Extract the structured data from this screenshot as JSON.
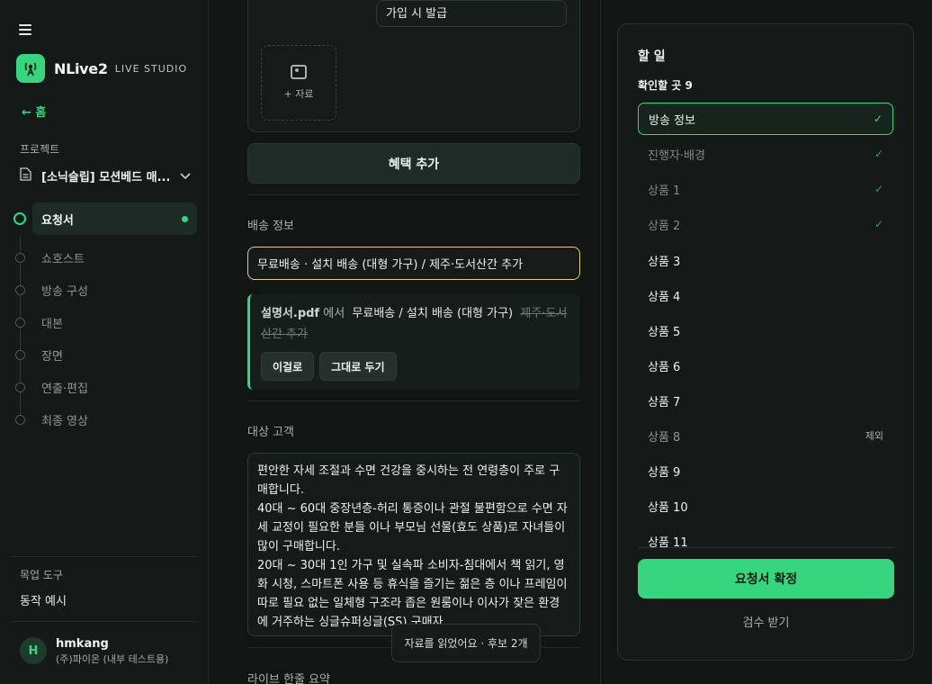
{
  "app": {
    "name": "NLive2",
    "subtitle": "LIVE STUDIO",
    "home": "← 홈"
  },
  "sidebar": {
    "project_label": "프로젝트",
    "project_name": "[소닉슬립] 모션베드 매...",
    "steps": [
      {
        "label": "요청서",
        "active": true
      },
      {
        "label": "쇼호스트"
      },
      {
        "label": "방송 구성"
      },
      {
        "label": "대본"
      },
      {
        "label": "장면"
      },
      {
        "label": "연출·편집"
      },
      {
        "label": "최종 영상"
      }
    ],
    "tools_label": "목업 도구",
    "tools_item": "동작 예시",
    "user": {
      "initial": "H",
      "name": "hmkang",
      "org": "(주)파이온 (내부 테스트용)"
    }
  },
  "main": {
    "benefit_field_value": "가입 시 발급",
    "upload_label": "+ 자료",
    "add_benefit_button": "혜택 추가",
    "shipping": {
      "label": "배송 정보",
      "value": "무료배송 · 설치 배송 (대형 가구) / 제주·도서산간 추가",
      "suggestion_source": "설명서.pdf",
      "suggestion_from": "에서",
      "suggestion_text": "무료배송 / 설치 배송 (대형 가구)",
      "suggestion_strike": "제주·도서산간 추가",
      "accept_button": "이걸로",
      "keep_button": "그대로 두기"
    },
    "target": {
      "label": "대상 고객",
      "lines": [
        "편안한 자세 조절과 수면 건강을 중시하는 전 연령층이 주로 구매합니다.",
        "40대 ~ 60대 중장년층-허리 통증이나 관절 불편함으로 수면 자세 교정이 필요한 분들 이나 부모님 선물(효도 상품)로 자녀들이 많이 구매합니다.",
        "20대 ~ 30대 1인 가구 및 실속파 소비자-침대에서 책 읽기, 영화 시청, 스마트폰 사용 등 휴식을 즐기는 젊은 층 이나 프레임이 따로 필요 없는 일체형 구조라 좁은 원룸이나 이사가 잦은 환경에 거주하는 싱글슈퍼싱글(SS) 구매자."
      ]
    },
    "summary_label": "라이브 한줄 요약",
    "toast": "자료를 읽었어요 · 후보 2개"
  },
  "todo": {
    "title": "할 일",
    "count_label": "확인할 곳 9",
    "items": [
      {
        "label": "방송 정보",
        "state": "selected",
        "mark": "✓"
      },
      {
        "label": "진행자·배경",
        "state": "done",
        "mark": "✓"
      },
      {
        "label": "상품 1",
        "state": "done",
        "mark": "✓"
      },
      {
        "label": "상품 2",
        "state": "done",
        "mark": "✓"
      },
      {
        "label": "상품 3",
        "state": "todo"
      },
      {
        "label": "상품 4",
        "state": "todo"
      },
      {
        "label": "상품 5",
        "state": "todo"
      },
      {
        "label": "상품 6",
        "state": "todo"
      },
      {
        "label": "상품 7",
        "state": "todo"
      },
      {
        "label": "상품 8",
        "state": "excluded",
        "note": "제외"
      },
      {
        "label": "상품 9",
        "state": "todo"
      },
      {
        "label": "상품 10",
        "state": "todo"
      },
      {
        "label": "상품 11",
        "state": "todo"
      }
    ],
    "confirm_button": "요청서 확정",
    "review_link": "검수 받기"
  },
  "colors": {
    "accent": "#35d67e",
    "background": "#111614",
    "input_focus": "#e6cd7c"
  }
}
